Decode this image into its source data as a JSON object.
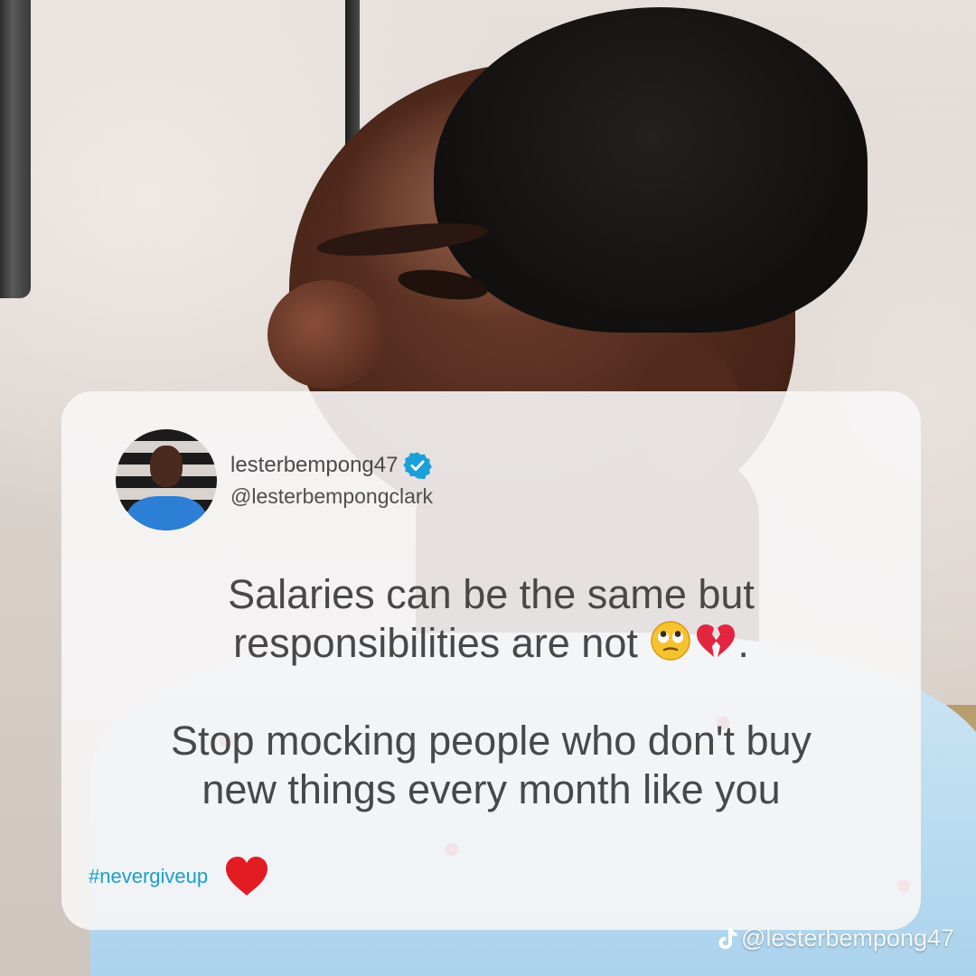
{
  "colors": {
    "card_background": "#f7f6f6",
    "text": "#484848",
    "hashtag": "#1aa0c9",
    "verified_badge": "#1a9fd9",
    "heart": "#e31b23"
  },
  "post": {
    "author": {
      "display_name": "lesterbempong47",
      "handle": "@lesterbempongclark",
      "verified": true,
      "avatar": "profile-photo"
    },
    "text_line1": "Salaries can be the same but",
    "text_line2": "responsibilities are not",
    "line2_suffix": ".",
    "emojis": [
      "face-with-rolling-eyes",
      "broken-heart"
    ],
    "text_para2_line1": "Stop mocking people who don't buy",
    "text_para2_line2": "new things every month like you",
    "hashtag": "#nevergiveup",
    "footer_icon": "red-heart"
  },
  "watermark": {
    "icon": "tiktok-icon",
    "text": "@lesterbempong47"
  }
}
